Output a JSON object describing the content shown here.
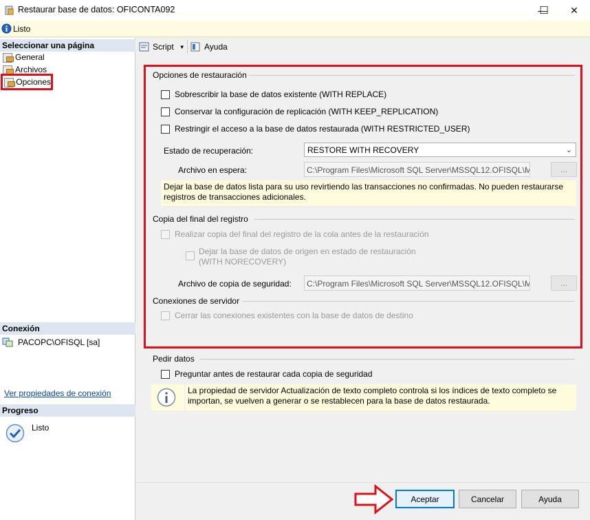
{
  "window": {
    "title": "Restaurar base de datos: OFICONTA092",
    "minimize": "—",
    "maximize": "☐",
    "close": "✕"
  },
  "status": {
    "text": "Listo"
  },
  "left": {
    "select_header": "Seleccionar una página",
    "pages": [
      {
        "label": "General"
      },
      {
        "label": "Archivos"
      },
      {
        "label": "Opciones"
      }
    ],
    "connection_header": "Conexión",
    "connection_value": "PACOPC\\OFISQL [sa]",
    "connection_link": "Ver propiedades de conexión",
    "progress_header": "Progreso",
    "progress_value": "Listo"
  },
  "toolbar": {
    "script": "Script",
    "help": "Ayuda"
  },
  "restore_options": {
    "label": "Opciones de restauración",
    "with_replace": "Sobrescribir la base de datos existente (WITH REPLACE)",
    "keep_replication": "Conservar la configuración de replicación (WITH KEEP_REPLICATION)",
    "restricted_user": "Restringir el acceso a la base de datos restaurada (WITH RESTRICTED_USER)",
    "recovery_label": "Estado de recuperación:",
    "recovery_value": "RESTORE WITH RECOVERY",
    "standby_label": "Archivo en espera:",
    "standby_value": "C:\\Program Files\\Microsoft SQL Server\\MSSQL12.OFISQL\\MS",
    "note": "Dejar la base de datos lista para su uso revirtiendo las transacciones no confirmadas. No pueden restaurarse registros de transacciones adicionales."
  },
  "tail_log": {
    "label": "Copia del final del registro",
    "take_backup": "Realizar copia del final del registro de la cola antes de la restauración",
    "norecovery_line1": "Dejar la base de datos de origen en estado de restauración",
    "norecovery_line2": "(WITH NORECOVERY)",
    "backup_file_label": "Archivo de copia de seguridad:",
    "backup_file_value": "C:\\Program Files\\Microsoft SQL Server\\MSSQL12.OFISQL\\MS"
  },
  "server_connections": {
    "label": "Conexiones de servidor",
    "close_existing": "Cerrar las conexiones existentes con la base de datos de destino"
  },
  "prompt": {
    "label": "Pedir datos",
    "ask_before": "Preguntar antes de restaurar cada copia de seguridad",
    "info": "La propiedad de servidor Actualización de texto completo controla si los índices de texto completo se importan, se vuelven a generar o se restablecen para la base de datos restaurada."
  },
  "buttons": {
    "ok": "Aceptar",
    "cancel": "Cancelar",
    "help": "Ayuda"
  },
  "ellipsis": "...",
  "colors": {
    "highlight": "#e0101a",
    "accent": "#0078d7"
  }
}
